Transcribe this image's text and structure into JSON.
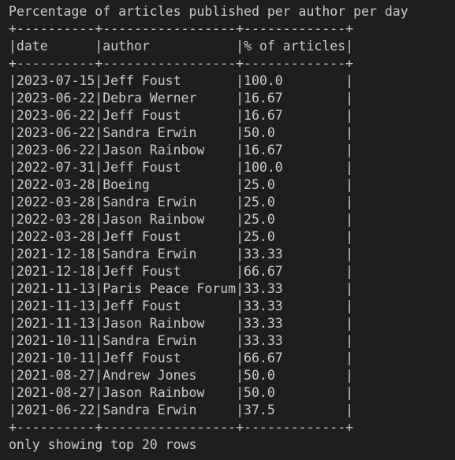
{
  "output": {
    "title": "Percentage of articles published per author per day",
    "border": "+----------+-----------------+-------------+",
    "header": "|date      |author           |% of articles|",
    "rows": [
      "|2023-07-15|Jeff Foust       |100.0        |",
      "|2023-06-22|Debra Werner     |16.67        |",
      "|2023-06-22|Jeff Foust       |16.67        |",
      "|2023-06-22|Sandra Erwin     |50.0         |",
      "|2023-06-22|Jason Rainbow    |16.67        |",
      "|2022-07-31|Jeff Foust       |100.0        |",
      "|2022-03-28|Boeing           |25.0         |",
      "|2022-03-28|Sandra Erwin     |25.0         |",
      "|2022-03-28|Jason Rainbow    |25.0         |",
      "|2022-03-28|Jeff Foust       |25.0         |",
      "|2021-12-18|Sandra Erwin     |33.33        |",
      "|2021-12-18|Jeff Foust       |66.67        |",
      "|2021-11-13|Paris Peace Forum|33.33        |",
      "|2021-11-13|Jeff Foust       |33.33        |",
      "|2021-11-13|Jason Rainbow    |33.33        |",
      "|2021-10-11|Sandra Erwin     |33.33        |",
      "|2021-10-11|Jeff Foust       |66.67        |",
      "|2021-08-27|Andrew Jones     |50.0         |",
      "|2021-08-27|Jason Rainbow    |50.0         |",
      "|2021-06-22|Sandra Erwin     |37.5         |"
    ],
    "footer": "only showing top 20 rows"
  }
}
